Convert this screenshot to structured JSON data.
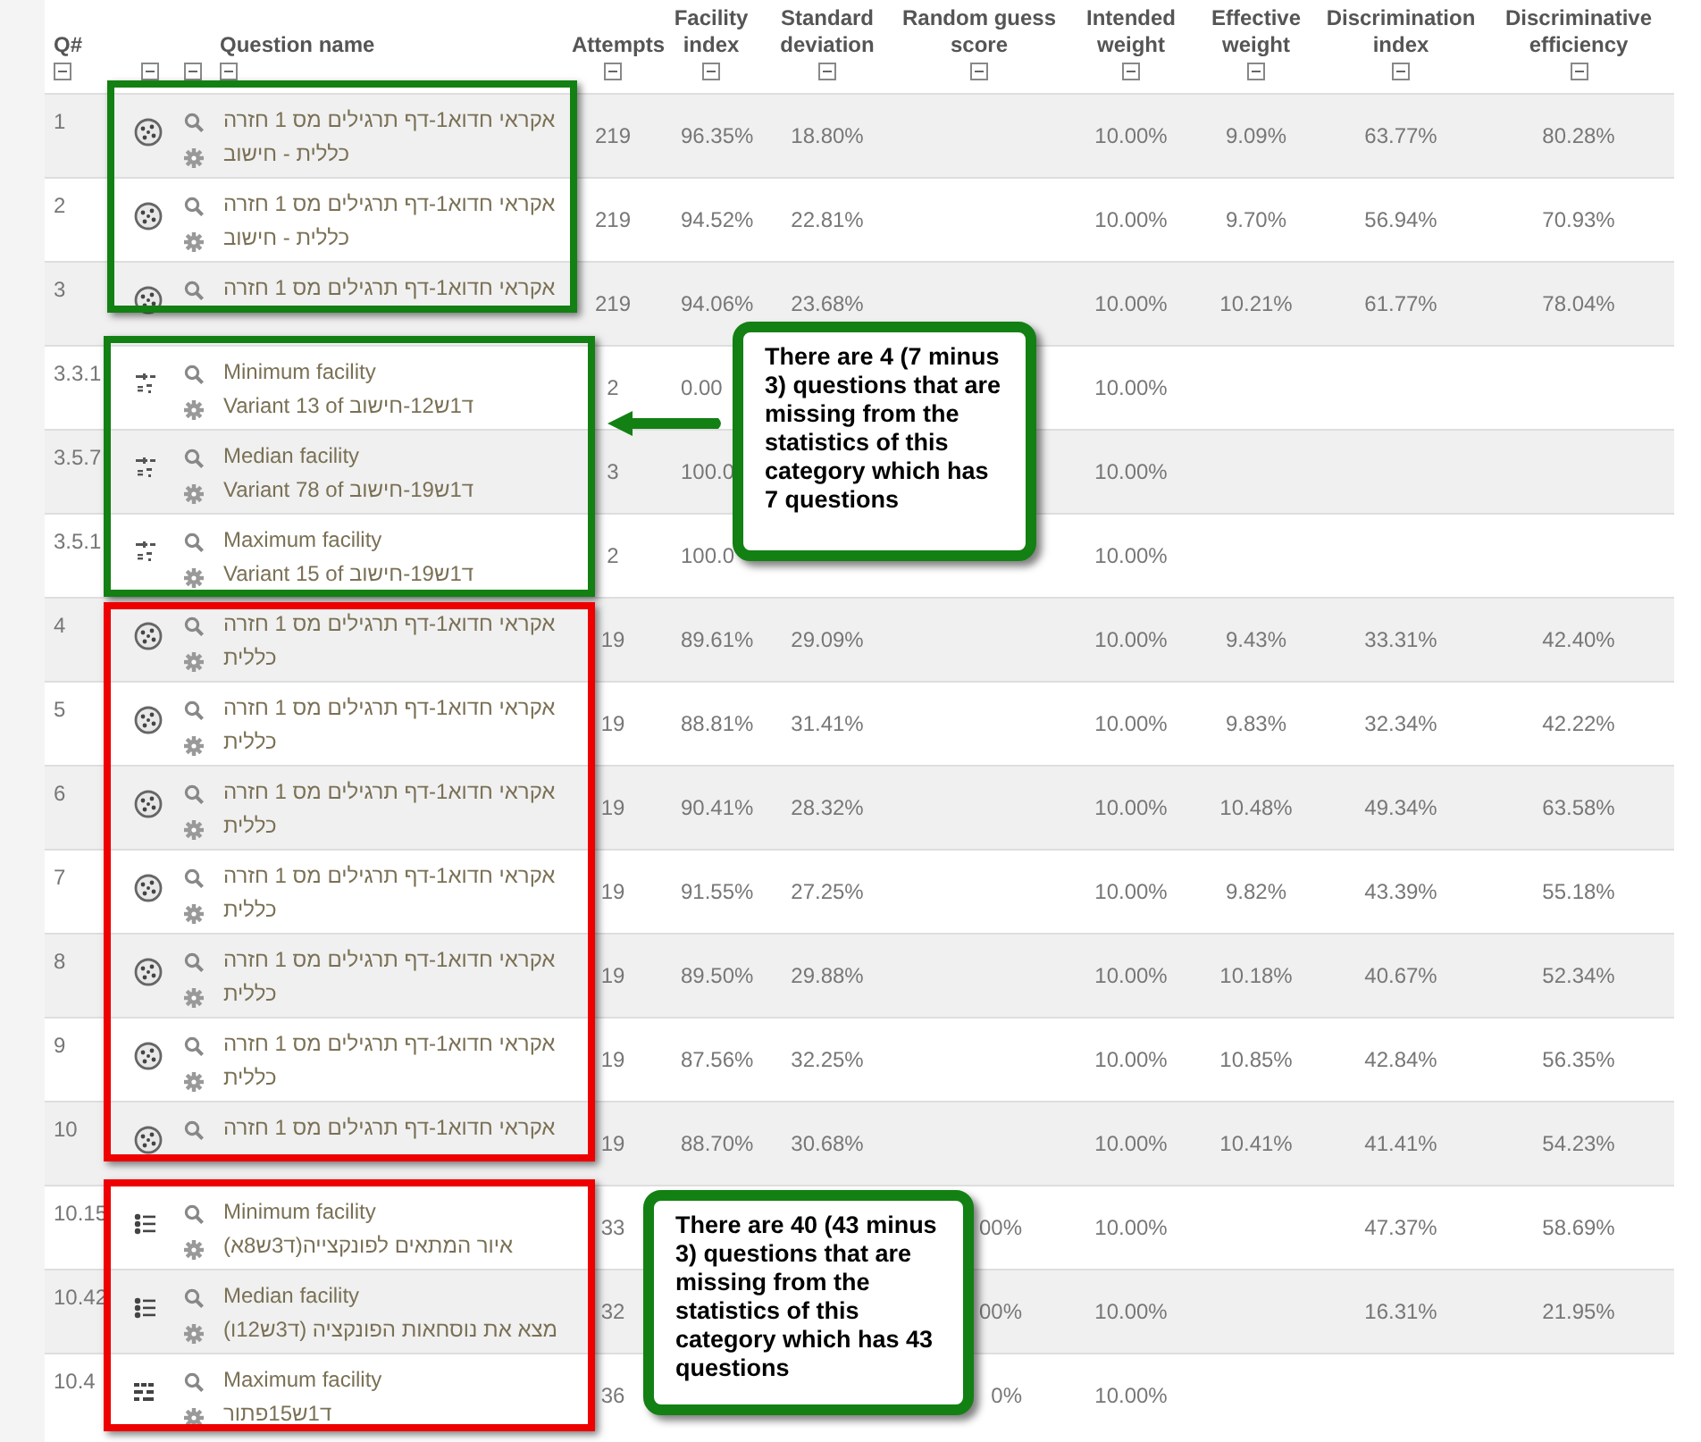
{
  "table": {
    "columns": [
      "Q#",
      "Question name",
      "Attempts",
      "Facility index",
      "Standard deviation",
      "Random guess score",
      "Intended weight",
      "Effective weight",
      "Discrimination index",
      "Discriminative efficiency"
    ],
    "groups": [
      {
        "color": "#138013",
        "rows": [
          {
            "q": "1",
            "kind": "random",
            "name": [
              "אקראי חדוא1-דף תרגילים מס 1 חזרה",
              "כללית - חישוב"
            ],
            "attempts": "219",
            "facility": "96.35%",
            "sd": "18.80%",
            "intended": "10.00%",
            "effective": "9.09%",
            "discrimination": "63.77%",
            "efficiency": "80.28%"
          },
          {
            "q": "2",
            "kind": "random",
            "name": [
              "אקראי חדוא1-דף תרגילים מס 1 חזרה",
              "כללית - חישוב"
            ],
            "attempts": "219",
            "facility": "94.52%",
            "sd": "22.81%",
            "intended": "10.00%",
            "effective": "9.70%",
            "discrimination": "56.94%",
            "efficiency": "70.93%"
          },
          {
            "q": "3",
            "kind": "random",
            "name": [
              "אקראי חדוא1-דף תרגילים מס 1 חזרה"
            ],
            "attempts": "219",
            "facility": "94.06%",
            "sd": "23.68%",
            "intended": "10.00%",
            "effective": "10.21%",
            "discrimination": "61.77%",
            "efficiency": "78.04%"
          }
        ]
      },
      {
        "color": "#138013",
        "callout": {
          "text": "There are 4 (7 minus 3) questions that are missing from the statistics of this category which has 7 questions",
          "arrow": true
        },
        "rows": [
          {
            "q": "3.3.1",
            "kind": "calculated",
            "name": [
              "Minimum facility",
              "Variant 13 of ד1ש12-חישוב"
            ],
            "attempts": "2",
            "facility": "0.00",
            "intended": "10.00%"
          },
          {
            "q": "3.5.7",
            "kind": "calculated",
            "name": [
              "Median facility",
              "Variant 78 of ד1ש19-חישוב"
            ],
            "attempts": "3",
            "facility": "100.0",
            "intended": "10.00%"
          },
          {
            "q": "3.5.1",
            "kind": "calculated",
            "name": [
              "Maximum facility",
              "Variant 15 of ד1ש19-חישוב"
            ],
            "attempts": "2",
            "facility": "100.0",
            "intended": "10.00%"
          }
        ]
      },
      {
        "color": "#ee0000",
        "rows": [
          {
            "q": "4",
            "kind": "random",
            "name": [
              "אקראי חדוא1-דף תרגילים מס 1 חזרה",
              "כללית"
            ],
            "attempts": "19",
            "facility": "89.61%",
            "sd": "29.09%",
            "intended": "10.00%",
            "effective": "9.43%",
            "discrimination": "33.31%",
            "efficiency": "42.40%"
          },
          {
            "q": "5",
            "kind": "random",
            "name": [
              "אקראי חדוא1-דף תרגילים מס 1 חזרה",
              "כללית"
            ],
            "attempts": "19",
            "facility": "88.81%",
            "sd": "31.41%",
            "intended": "10.00%",
            "effective": "9.83%",
            "discrimination": "32.34%",
            "efficiency": "42.22%"
          },
          {
            "q": "6",
            "kind": "random",
            "name": [
              "אקראי חדוא1-דף תרגילים מס 1 חזרה",
              "כללית"
            ],
            "attempts": "19",
            "facility": "90.41%",
            "sd": "28.32%",
            "intended": "10.00%",
            "effective": "10.48%",
            "discrimination": "49.34%",
            "efficiency": "63.58%"
          },
          {
            "q": "7",
            "kind": "random",
            "name": [
              "אקראי חדוא1-דף תרגילים מס 1 חזרה",
              "כללית"
            ],
            "attempts": "19",
            "facility": "91.55%",
            "sd": "27.25%",
            "intended": "10.00%",
            "effective": "9.82%",
            "discrimination": "43.39%",
            "efficiency": "55.18%"
          },
          {
            "q": "8",
            "kind": "random",
            "name": [
              "אקראי חדוא1-דף תרגילים מס 1 חזרה",
              "כללית"
            ],
            "attempts": "19",
            "facility": "89.50%",
            "sd": "29.88%",
            "intended": "10.00%",
            "effective": "10.18%",
            "discrimination": "40.67%",
            "efficiency": "52.34%"
          },
          {
            "q": "9",
            "kind": "random",
            "name": [
              "אקראי חדוא1-דף תרגילים מס 1 חזרה",
              "כללית"
            ],
            "attempts": "19",
            "facility": "87.56%",
            "sd": "32.25%",
            "intended": "10.00%",
            "effective": "10.85%",
            "discrimination": "42.84%",
            "efficiency": "56.35%"
          },
          {
            "q": "10",
            "kind": "random",
            "name": [
              "אקראי חדוא1-דף תרגילים מס 1 חזרה"
            ],
            "attempts": "19",
            "facility": "88.70%",
            "sd": "30.68%",
            "intended": "10.00%",
            "effective": "10.41%",
            "discrimination": "41.41%",
            "efficiency": "54.23%"
          }
        ]
      },
      {
        "color": "#ee0000",
        "callout": {
          "text": "There are 40 (43 minus 3) questions that are missing from the statistics of this category which has 43 questions",
          "arrow": false
        },
        "rows": [
          {
            "q": "10.15",
            "kind": "list",
            "name": [
              "Minimum facility",
              "איור המתאים לפונקצייה(ד3ש8א)"
            ],
            "attempts": "33",
            "guess": "00%",
            "intended": "10.00%",
            "discrimination": "47.37%",
            "efficiency": "58.69%"
          },
          {
            "q": "10.42",
            "kind": "list",
            "name": [
              "Median facility",
              "מצא את נוסחאות הפונקציה (ד3ש12ו)"
            ],
            "attempts": "32",
            "guess": "00%",
            "intended": "10.00%",
            "discrimination": "16.31%",
            "efficiency": "21.95%"
          },
          {
            "q": "10.4",
            "kind": "grid",
            "name": [
              "Maximum facility",
              "ד1ש15פתור"
            ],
            "attempts": "36",
            "guess": "0%",
            "intended": "10.00%"
          }
        ]
      }
    ]
  }
}
